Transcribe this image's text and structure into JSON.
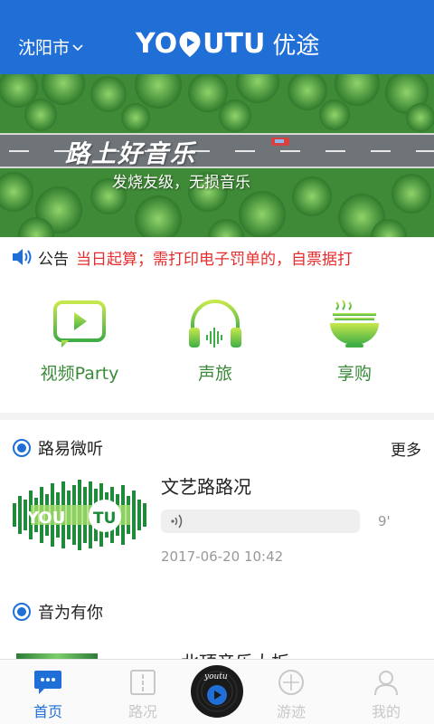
{
  "header": {
    "city": "沈阳市",
    "logo_en_left": "YO",
    "logo_en_right": "UTU",
    "logo_cn": "优途",
    "color": "#1f6fd6"
  },
  "banner": {
    "title": "路上好音乐",
    "subtitle": "发烧友级，无损音乐"
  },
  "notice": {
    "icon": "speaker-icon",
    "label": "公告",
    "text": "当日起算；需打印电子罚单的，自票据打"
  },
  "quick": [
    {
      "label": "视频Party",
      "icon": "video-play-icon"
    },
    {
      "label": "声旅",
      "icon": "headphones-icon"
    },
    {
      "label": "享购",
      "icon": "bowl-icon"
    }
  ],
  "sections": {
    "first": {
      "title": "路易微听",
      "more": "更多"
    },
    "second": {
      "title": "音为有你"
    }
  },
  "audio_item": {
    "title": "文艺路路况",
    "duration": "9'",
    "date": "2017-06-20 10:42",
    "thumb_text_left": "YOU",
    "thumb_text_right": "TU"
  },
  "next_item_partial": {
    "title": "北顶音乐大板"
  },
  "tabbar": {
    "tabs": [
      {
        "label": "首页",
        "icon": "chat-bubble-icon",
        "active": true
      },
      {
        "label": "路况",
        "icon": "road-icon",
        "active": false
      },
      {
        "label": "游迹",
        "icon": "compass-icon",
        "active": false
      },
      {
        "label": "我的",
        "icon": "user-icon",
        "active": false
      }
    ],
    "center_label": "youtu",
    "active_color": "#1f6fd6"
  }
}
